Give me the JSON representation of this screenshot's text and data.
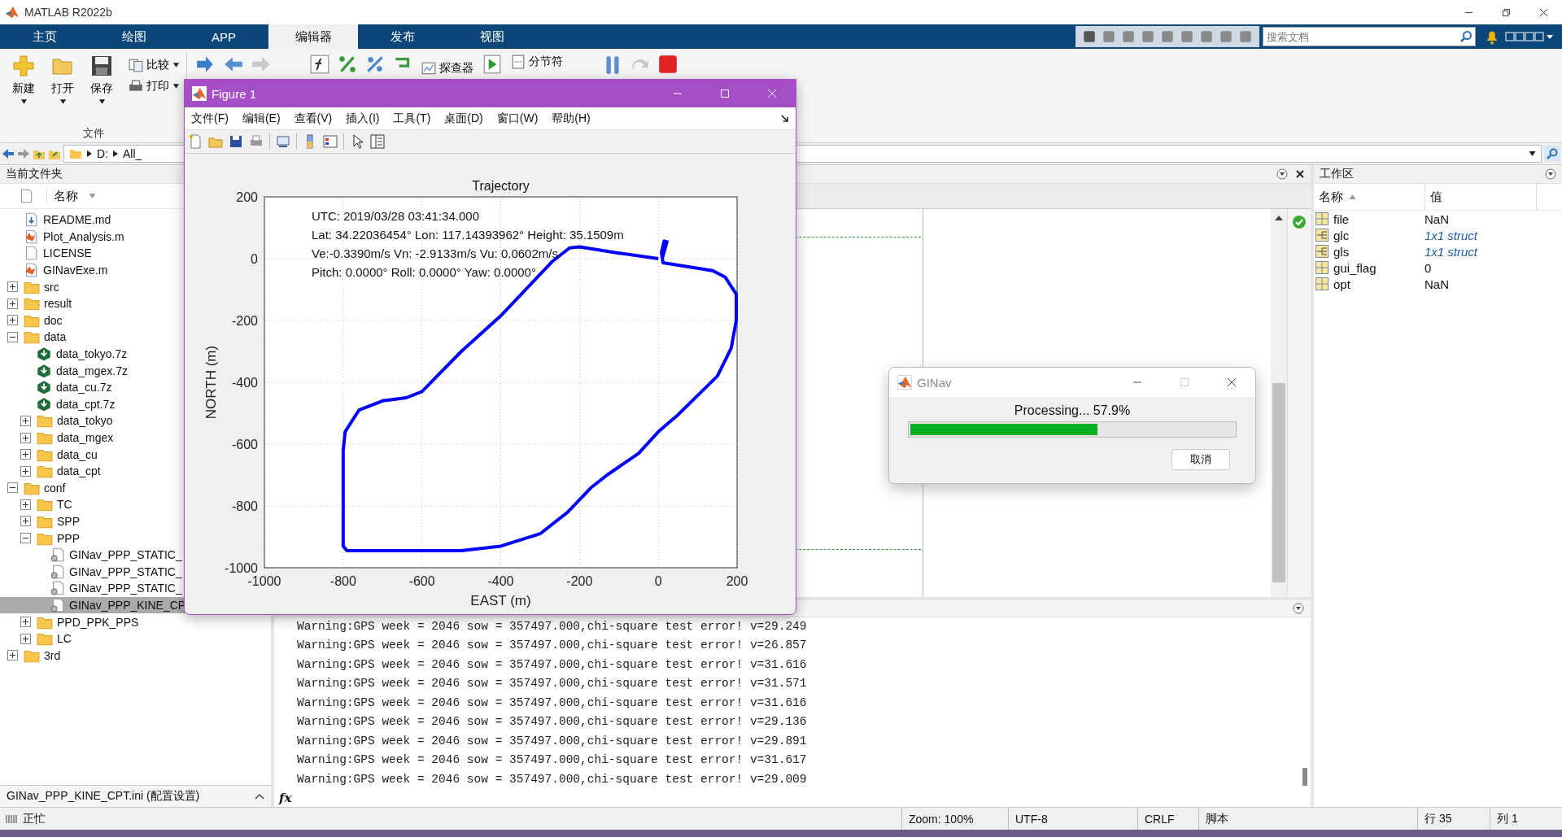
{
  "app_title": "MATLAB R2022b",
  "ribbon_tabs": [
    {
      "label": "主页",
      "selected": false
    },
    {
      "label": "绘图",
      "selected": false
    },
    {
      "label": "APP",
      "selected": false
    },
    {
      "label": "编辑器",
      "selected": true
    },
    {
      "label": "发布",
      "selected": false
    },
    {
      "label": "视图",
      "selected": false
    }
  ],
  "search": {
    "placeholder": "搜索文档"
  },
  "ribbon": {
    "new": "新建",
    "open": "打开",
    "save": "保存",
    "compare": "比较",
    "print": "打印",
    "group": "文件",
    "profiler": "探查器",
    "section_break": "分节符"
  },
  "address": {
    "segments": [
      "D:",
      "All_"
    ]
  },
  "file_panel": {
    "title": "当前文件夹",
    "column": "名称",
    "detail": "GINav_PPP_KINE_CPT.ini  (配置设置)",
    "items": [
      {
        "name": "README.md",
        "kind": "markdown",
        "selected": false
      },
      {
        "name": "Plot_Analysis.m",
        "kind": "script",
        "selected": false
      },
      {
        "name": "LICENSE",
        "kind": "text",
        "selected": false
      },
      {
        "name": "GINavExe.m",
        "kind": "script",
        "selected": false
      },
      {
        "name": "src",
        "kind": "folder",
        "expanded": false,
        "selected": false
      },
      {
        "name": "result",
        "kind": "folder",
        "expanded": false,
        "selected": false
      },
      {
        "name": "doc",
        "kind": "folder",
        "expanded": false,
        "selected": false
      },
      {
        "name": "data",
        "kind": "folder",
        "expanded": true,
        "selected": false,
        "children": [
          {
            "name": "data_tokyo.7z",
            "kind": "archive",
            "selected": false
          },
          {
            "name": "data_mgex.7z",
            "kind": "archive",
            "selected": false
          },
          {
            "name": "data_cu.7z",
            "kind": "archive",
            "selected": false
          },
          {
            "name": "data_cpt.7z",
            "kind": "archive",
            "selected": false
          },
          {
            "name": "data_tokyo",
            "kind": "folder",
            "expanded": false,
            "selected": false
          },
          {
            "name": "data_mgex",
            "kind": "folder",
            "expanded": false,
            "selected": false
          },
          {
            "name": "data_cu",
            "kind": "folder",
            "expanded": false,
            "selected": false
          },
          {
            "name": "data_cpt",
            "kind": "folder",
            "expanded": false,
            "selected": false
          }
        ]
      },
      {
        "name": "conf",
        "kind": "folder",
        "expanded": true,
        "selected": false,
        "children": [
          {
            "name": "TC",
            "kind": "folder",
            "expanded": false,
            "selected": false
          },
          {
            "name": "SPP",
            "kind": "folder",
            "expanded": false,
            "selected": false
          },
          {
            "name": "PPP",
            "kind": "folder",
            "expanded": true,
            "selected": false,
            "children": [
              {
                "name": "GINav_PPP_STATIC_",
                "kind": "config",
                "selected": false
              },
              {
                "name": "GINav_PPP_STATIC_",
                "kind": "config",
                "selected": false
              },
              {
                "name": "GINav_PPP_STATIC_",
                "kind": "config",
                "selected": false
              },
              {
                "name": "GINav_PPP_KINE_CP",
                "kind": "config",
                "selected": true
              }
            ]
          },
          {
            "name": "PPD_PPK_PPS",
            "kind": "folder",
            "expanded": false,
            "selected": false
          },
          {
            "name": "LC",
            "kind": "folder",
            "expanded": false,
            "selected": false
          }
        ]
      },
      {
        "name": "3rd",
        "kind": "folder",
        "expanded": false,
        "selected": false
      }
    ]
  },
  "workspace": {
    "title": "工作区",
    "columns": [
      "名称",
      "值"
    ],
    "variables": [
      {
        "name": "file",
        "value": "NaN",
        "kind": "matrix"
      },
      {
        "name": "glc",
        "value": "1x1 struct",
        "kind": "struct"
      },
      {
        "name": "gls",
        "value": "1x1 struct",
        "kind": "struct"
      },
      {
        "name": "gui_flag",
        "value": "0",
        "kind": "matrix"
      },
      {
        "name": "opt",
        "value": "NaN",
        "kind": "matrix"
      }
    ]
  },
  "console": {
    "prompt": "fx",
    "lines": [
      "Warning:GPS week = 2046 sow = 357497.000,chi-square test error! v=29.249",
      "Warning:GPS week = 2046 sow = 357497.000,chi-square test error! v=26.857",
      "Warning:GPS week = 2046 sow = 357497.000,chi-square test error! v=31.616",
      "Warning:GPS week = 2046 sow = 357497.000,chi-square test error! v=31.571",
      "Warning:GPS week = 2046 sow = 357497.000,chi-square test error! v=31.616",
      "Warning:GPS week = 2046 sow = 357497.000,chi-square test error! v=29.136",
      "Warning:GPS week = 2046 sow = 357497.000,chi-square test error! v=29.891",
      "Warning:GPS week = 2046 sow = 357497.000,chi-square test error! v=31.617",
      "Warning:GPS week = 2046 sow = 357497.000,chi-square test error! v=29.009"
    ]
  },
  "figure": {
    "title": "Figure 1",
    "menus": [
      "文件(F)",
      "编辑(E)",
      "查看(V)",
      "插入(I)",
      "工具(T)",
      "桌面(D)",
      "窗口(W)",
      "帮助(H)"
    ],
    "plot_text": [
      "UTC: 2019/03/28  03:41:34.000",
      "Lat: 34.22036454°  Lon: 117.14393962°  Height: 35.1509m",
      "Ve:-0.3390m/s   Vn: -2.9133m/s   Vu: 0.0602m/s",
      "Pitch: 0.0000°  Roll: 0.0000°  Yaw: 0.0000°"
    ],
    "chart_data": {
      "type": "line",
      "title": "Trajectory",
      "xlabel": "EAST (m)",
      "ylabel": "NORTH (m)",
      "x": [
        0,
        -100,
        -200,
        -225,
        -270,
        -400,
        -500,
        -600,
        -640,
        -700,
        -760,
        -795,
        -800,
        -800,
        -790,
        -500,
        -400,
        -300,
        -230,
        -170,
        -130,
        -50,
        0,
        50,
        150,
        185,
        198,
        198,
        170,
        138,
        12,
        8,
        15,
        22,
        10
      ],
      "grid": true,
      "series": [
        {
          "color": "#0000ff",
          "values": [
            0,
            18,
            38,
            35,
            -10,
            -185,
            -300,
            -430,
            -450,
            -460,
            -490,
            -560,
            -620,
            -930,
            -945,
            -945,
            -930,
            -890,
            -820,
            -740,
            -700,
            -630,
            -560,
            -505,
            -380,
            -290,
            -200,
            -115,
            -60,
            -39,
            -13,
            20,
            57,
            55,
            0
          ]
        }
      ],
      "xlim": [
        -1000,
        200
      ],
      "ylim": [
        -1000,
        200
      ],
      "xticks": [
        -1000,
        -800,
        -600,
        -400,
        -200,
        0,
        200
      ],
      "yticks": [
        -1000,
        -800,
        -600,
        -400,
        -200,
        0,
        200
      ]
    }
  },
  "dialog": {
    "title": "GINav",
    "message": "Processing... 57.9%",
    "level": 0.579,
    "button": "取消"
  },
  "status_bar": {
    "state": "正忙",
    "zoom": "Zoom: 100%",
    "encoding": "UTF-8",
    "line_ending": "CRLF",
    "type": "脚本",
    "line": "行 35",
    "column": "列 1"
  }
}
